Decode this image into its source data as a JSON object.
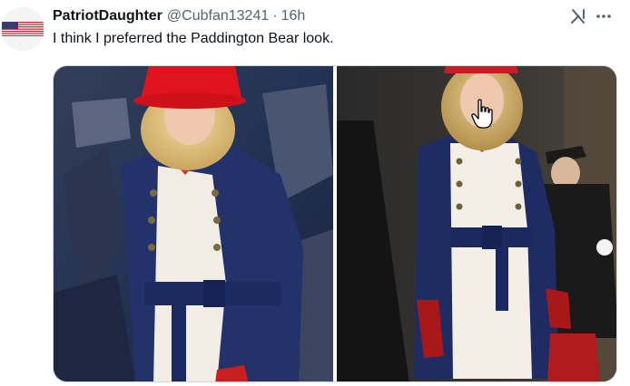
{
  "tweet": {
    "display_name": "PatriotDaughter",
    "handle": "@Cubfan13241",
    "separator": "·",
    "time": "16h",
    "text": "I think I preferred the Paddington Bear look."
  },
  "icons": {
    "avatar": "us-flag-avatar",
    "grok": "grok-icon",
    "more": "more-options-icon",
    "cursor": "hand-pointer-cursor-icon"
  },
  "colors": {
    "text_primary": "#0f1419",
    "text_secondary": "#536471",
    "border": "#cfd9de"
  }
}
